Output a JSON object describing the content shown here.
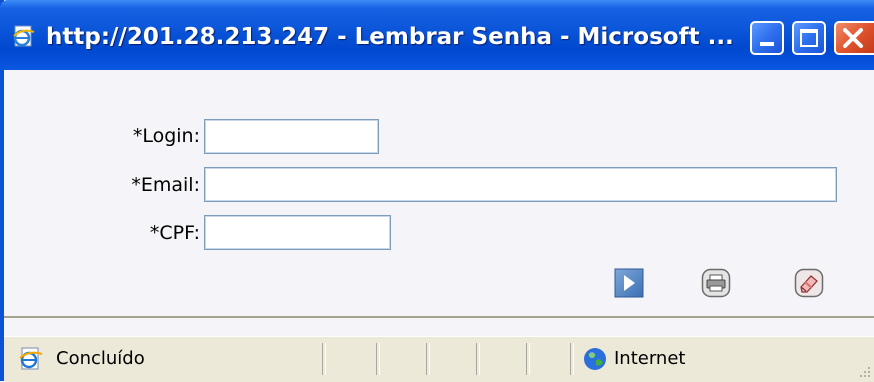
{
  "window": {
    "title": "http://201.28.213.247 - Lembrar Senha - Microsoft ...",
    "icon": "ie-page-icon",
    "controls": [
      "minimize-icon",
      "maximize-icon",
      "close-icon"
    ]
  },
  "form": {
    "login_label": "*Login:",
    "login_value": "",
    "email_label": "*Email:",
    "email_value": "",
    "cpf_label": "*CPF:",
    "cpf_value": ""
  },
  "actions": {
    "submit_icon": "play-arrow-icon",
    "print_icon": "printer-icon",
    "clear_icon": "eraser-icon"
  },
  "statusbar": {
    "status": "Concluído",
    "zone": "Internet"
  },
  "colors": {
    "titlebar": "#0a54d8",
    "close_button": "#e0542e",
    "field_border": "#7f9db9",
    "content_bg": "#f5f5f9"
  }
}
